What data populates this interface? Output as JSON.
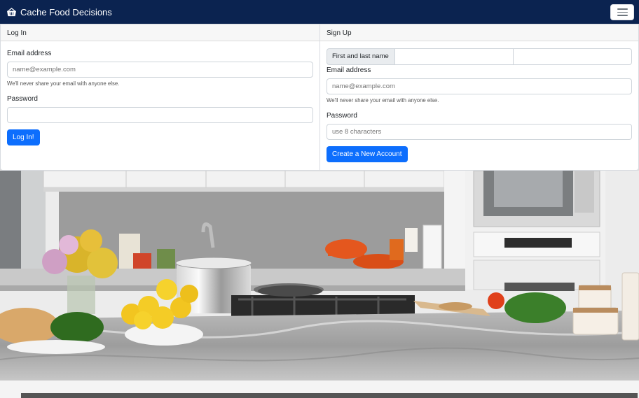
{
  "navbar": {
    "brand": "Cache Food Decisions",
    "brand_icon": "basket-icon",
    "menu_icon": "hamburger-menu-icon"
  },
  "login": {
    "header": "Log In",
    "email_label": "Email address",
    "email_placeholder": "name@example.com",
    "email_help": "We'll never share your email with anyone else.",
    "password_label": "Password",
    "password_placeholder": "",
    "submit": "Log In!"
  },
  "signup": {
    "header": "Sign Up",
    "name_label": "First and last name",
    "email_label": "Email address",
    "email_placeholder": "name@example.com",
    "email_help": "We'll never share your email with anyone else.",
    "password_label": "Password",
    "password_placeholder": "use 8 characters",
    "submit": "Create a New Account"
  },
  "colors": {
    "navbar": "#0b2350",
    "primary_button": "#0d6efd"
  }
}
